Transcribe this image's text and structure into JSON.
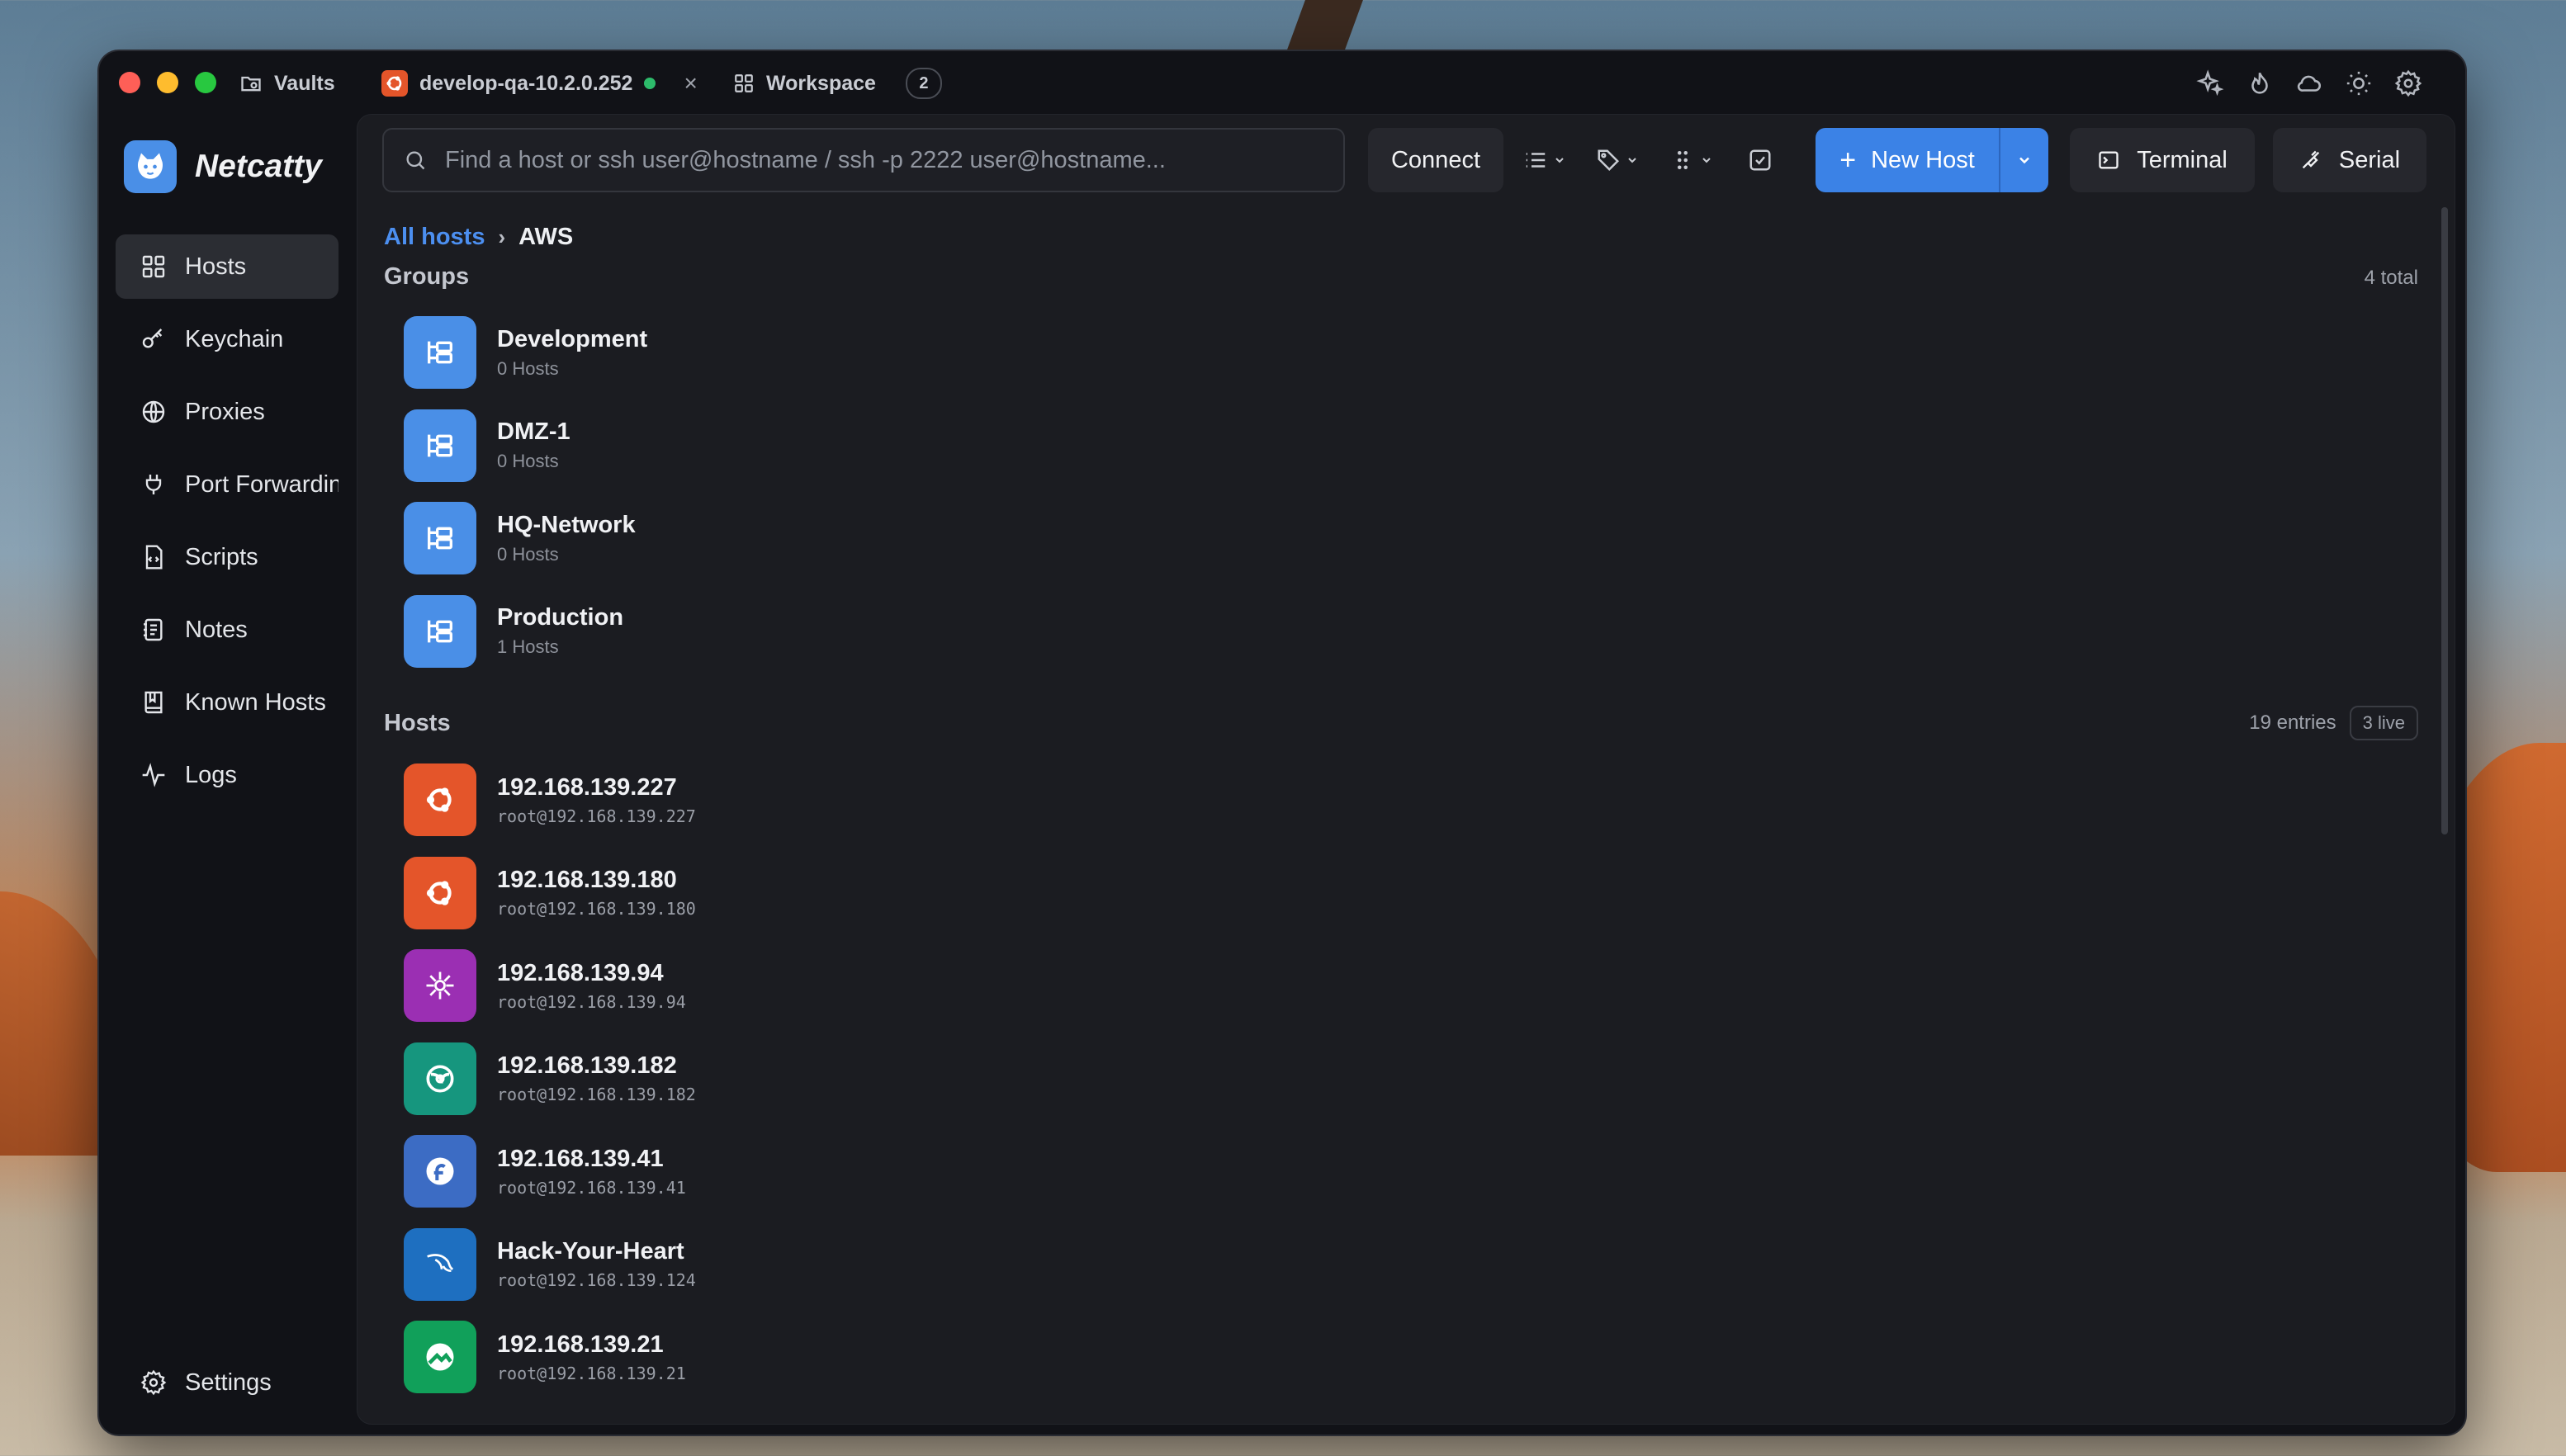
{
  "titlebar": {
    "vaults_label": "Vaults",
    "session_tab_label": "develop-qa-10.2.0.252",
    "workspace_label": "Workspace",
    "workspace_count": "2"
  },
  "brand": {
    "name": "Netcatty"
  },
  "sidebar": {
    "items": [
      {
        "label": "Hosts"
      },
      {
        "label": "Keychain"
      },
      {
        "label": "Proxies"
      },
      {
        "label": "Port Forwarding"
      },
      {
        "label": "Scripts"
      },
      {
        "label": "Notes"
      },
      {
        "label": "Known Hosts"
      },
      {
        "label": "Logs"
      }
    ],
    "settings_label": "Settings"
  },
  "toolbar": {
    "search_placeholder": "Find a host or ssh user@hostname / ssh -p 2222 user@hostname...",
    "connect_label": "Connect",
    "new_host_label": "New Host",
    "terminal_label": "Terminal",
    "serial_label": "Serial"
  },
  "breadcrumb": {
    "root": "All hosts",
    "separator": "›",
    "current": "AWS"
  },
  "groups": {
    "title": "Groups",
    "count": "4 total",
    "items": [
      {
        "name": "Development",
        "hosts": "0 Hosts"
      },
      {
        "name": "DMZ-1",
        "hosts": "0 Hosts"
      },
      {
        "name": "HQ-Network",
        "hosts": "0 Hosts"
      },
      {
        "name": "Production",
        "hosts": "1 Hosts"
      }
    ]
  },
  "hosts": {
    "title": "Hosts",
    "entries": "19 entries",
    "live": "3 live",
    "items": [
      {
        "name": "192.168.139.227",
        "address": "root@192.168.139.227",
        "os": "ubuntu",
        "color": "#e4552a"
      },
      {
        "name": "192.168.139.180",
        "address": "root@192.168.139.180",
        "os": "ubuntu",
        "color": "#e4552a"
      },
      {
        "name": "192.168.139.94",
        "address": "root@192.168.139.94",
        "os": "almalinux",
        "color": "#9b2fb3"
      },
      {
        "name": "192.168.139.182",
        "address": "root@192.168.139.182",
        "os": "opensuse",
        "color": "#16967e"
      },
      {
        "name": "192.168.139.41",
        "address": "root@192.168.139.41",
        "os": "fedora",
        "color": "#3c6cc4"
      },
      {
        "name": "Hack-Your-Heart",
        "address": "root@192.168.139.124",
        "os": "kali",
        "color": "#1e6fc0"
      },
      {
        "name": "192.168.139.21",
        "address": "root@192.168.139.21",
        "os": "rocky",
        "color": "#11a05a"
      }
    ]
  },
  "colors": {
    "accent": "#3b82e6",
    "link": "#4c8ff0",
    "group_icon_bg": "#4a8fe7",
    "online": "#2dbb6b"
  }
}
